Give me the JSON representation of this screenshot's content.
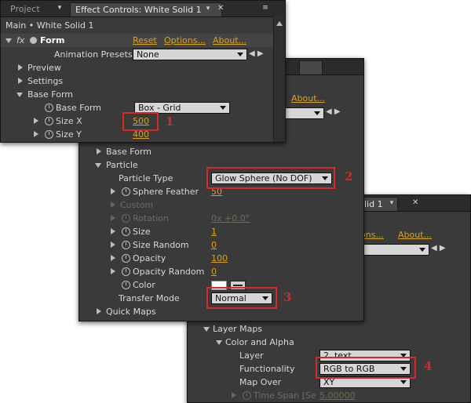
{
  "panel3": {
    "title_fragment": "lid 1",
    "menu_glyph": "▾",
    "close_glyph": "✕",
    "header_links": {
      "options": "ons...",
      "about": "About..."
    },
    "rows": {
      "layer_maps": "Layer Maps",
      "color_alpha": "Color and Alpha",
      "layer": {
        "label": "Layer",
        "value": "2. text"
      },
      "functionality": {
        "label": "Functionality",
        "value": "RGB to RGB"
      },
      "map_over": {
        "label": "Map Over",
        "value": "XY"
      },
      "time_span": {
        "label": "Time Span [Se",
        "value": "5.00000"
      }
    }
  },
  "panel2": {
    "header_links": {
      "about": "About..."
    },
    "rows": {
      "base_form": "Base Form",
      "particle": "Particle",
      "particle_type": {
        "label": "Particle Type",
        "value": "Glow Sphere (No DOF)"
      },
      "sphere_feather": {
        "label": "Sphere Feather",
        "value": "50"
      },
      "custom": "Custom",
      "rotation": {
        "label": "Rotation",
        "value": "0x +0.0°"
      },
      "size": {
        "label": "Size",
        "value": "1"
      },
      "size_random": {
        "label": "Size Random",
        "value": "0"
      },
      "opacity": {
        "label": "Opacity",
        "value": "100"
      },
      "opacity_random": {
        "label": "Opacity Random",
        "value": "0"
      },
      "color": {
        "label": "Color"
      },
      "transfer_mode": {
        "label": "Transfer Mode",
        "value": "Normal"
      },
      "quick_maps": "Quick Maps"
    }
  },
  "panel1": {
    "tabs": {
      "project": "Project",
      "effect_controls": "Effect Controls: White Solid 1"
    },
    "menu_glyph": "▾",
    "close_glyph": "✕",
    "breadcrumb": "Main • White Solid 1",
    "effect": {
      "fx_glyph": "fx",
      "name": "Form",
      "reset": "Reset",
      "options": "Options...",
      "about": "About..."
    },
    "rows": {
      "animation_presets": {
        "label": "Animation Presets:",
        "value": "None"
      },
      "preview": "Preview",
      "settings": "Settings",
      "base_form": "Base Form",
      "base_form_prop": {
        "label": "Base Form",
        "value": "Box - Grid"
      },
      "size_x": {
        "label": "Size X",
        "value": "500"
      },
      "size_y": {
        "label": "Size Y",
        "value": "400"
      }
    }
  },
  "callouts": [
    "1",
    "2",
    "3",
    "4"
  ],
  "colors": {
    "accent_value": "#d9a31a",
    "callout_red": "#d42a2a",
    "panel_bg": "#3a3a3a"
  }
}
